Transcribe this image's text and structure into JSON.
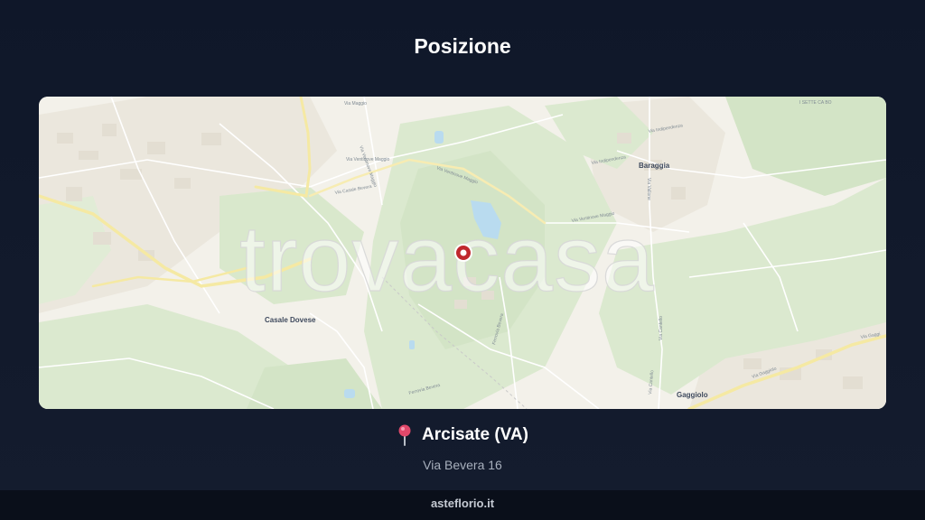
{
  "header": {
    "title": "Posizione"
  },
  "map": {
    "watermark": "trovacasa",
    "labels": {
      "casale_dovese": "Casale Dovese",
      "baraggia": "Baraggia",
      "gaggiolo": "Gaggiolo",
      "via_maggio": "Via Maggio",
      "via_ventinove_maggio_1": "Via Ventinove Maggio",
      "via_ventinove_maggio_2": "Via Ventinove Maggio",
      "via_ventinove_maggio_3": "Via Ventinove Maggio",
      "via_ventinove_maggio_4": "Via Ventinove Maggio",
      "via_casale_bevera": "Via Casale Bevera",
      "via_indipendenza_1": "Via Indipendenza",
      "via_indipendenza_2": "Via Indipendenza",
      "via_vallone": "Via Vallone",
      "via_cantello_1": "Via Cantello",
      "via_cantello_2": "Via Cantello",
      "via_gaggiolo_1": "Via Gaggiolo",
      "via_gaggiolo_2": "Via Gaggi",
      "ferrovia_bevera": "Ferrovia Bevera",
      "roggia_bevera": "Ferrovia Bevera",
      "corner_small": "I SETTE CA BO"
    },
    "colors": {
      "land": "#f3f1ea",
      "green": "#dbe9cf",
      "green_dark": "#cfe2c1",
      "water": "#b9dbef",
      "road_major": "#f5e9a3",
      "marker": "#c0282d"
    }
  },
  "location": {
    "pin_icon": "round-pushpin-icon",
    "city": "Arcisate (VA)",
    "address": "Via Bevera 16"
  },
  "footer": {
    "site": "asteflorio.it"
  }
}
